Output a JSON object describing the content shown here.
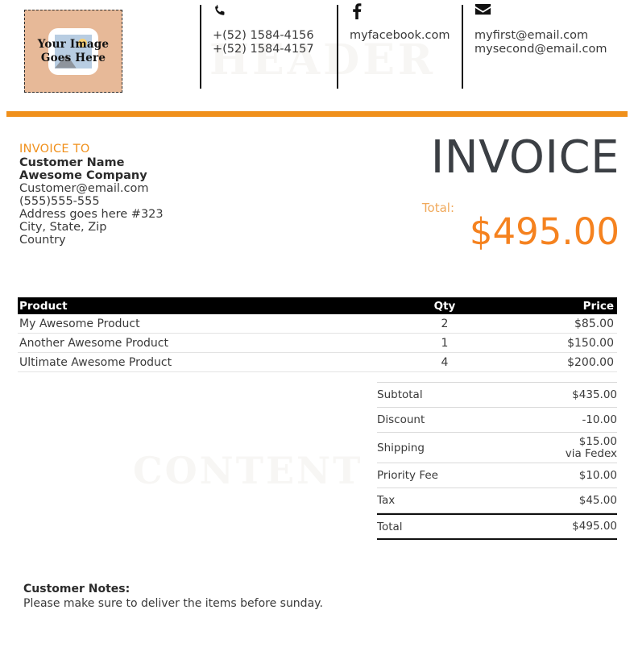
{
  "header": {
    "watermark": "HEADER",
    "logo": {
      "text_line1": "Your Image",
      "text_line2": "Goes Here",
      "icon": "picture-placeholder-icon"
    },
    "contacts": [
      {
        "icon": "phone-icon",
        "lines": [
          "+(52) 1584-4156",
          "+(52) 1584-4157"
        ]
      },
      {
        "icon": "facebook-icon",
        "lines": [
          "myfacebook.com"
        ]
      },
      {
        "icon": "envelope-icon",
        "lines": [
          "myfirst@email.com",
          "mysecond@email.com"
        ]
      }
    ]
  },
  "invoice": {
    "title": "INVOICE",
    "to_label": "INVOICE TO",
    "customer_name": "Customer Name",
    "customer_company": "Awesome Company",
    "customer_email": "Customer@email.com",
    "customer_phone": "(555)555-555",
    "customer_address": "Address goes here #323",
    "customer_city": "City, State, Zip",
    "customer_country": "Country",
    "total_label": "Total:",
    "total_amount": "$495.00"
  },
  "products": {
    "columns": [
      "Product",
      "Qty",
      "Price"
    ],
    "rows": [
      {
        "product": "My Awesome Product",
        "qty": "2",
        "price": "$85.00"
      },
      {
        "product": "Another Awesome Product",
        "qty": "1",
        "price": "$150.00"
      },
      {
        "product": "Ultimate Awesome Product",
        "qty": "4",
        "price": "$200.00"
      }
    ]
  },
  "totals": [
    {
      "label": "Subtotal",
      "value": "$435.00",
      "sub": ""
    },
    {
      "label": "Discount",
      "value": "-10.00",
      "sub": ""
    },
    {
      "label": "Shipping",
      "value": "$15.00",
      "sub": "via Fedex"
    },
    {
      "label": "Priority Fee",
      "value": "$10.00",
      "sub": ""
    },
    {
      "label": "Tax",
      "value": "$45.00",
      "sub": ""
    },
    {
      "label": "Total",
      "value": "$495.00",
      "sub": ""
    }
  ],
  "content_watermark": "CONTENT",
  "notes": {
    "title": "Customer Notes:",
    "text": "Please make sure to deliver the items before sunday."
  },
  "colors": {
    "accent_orange": "#f0901b",
    "total_orange": "#f5821f",
    "label_orange": "#f0a95b",
    "logo_bg": "#e7b998",
    "table_header_bg": "#000000"
  }
}
